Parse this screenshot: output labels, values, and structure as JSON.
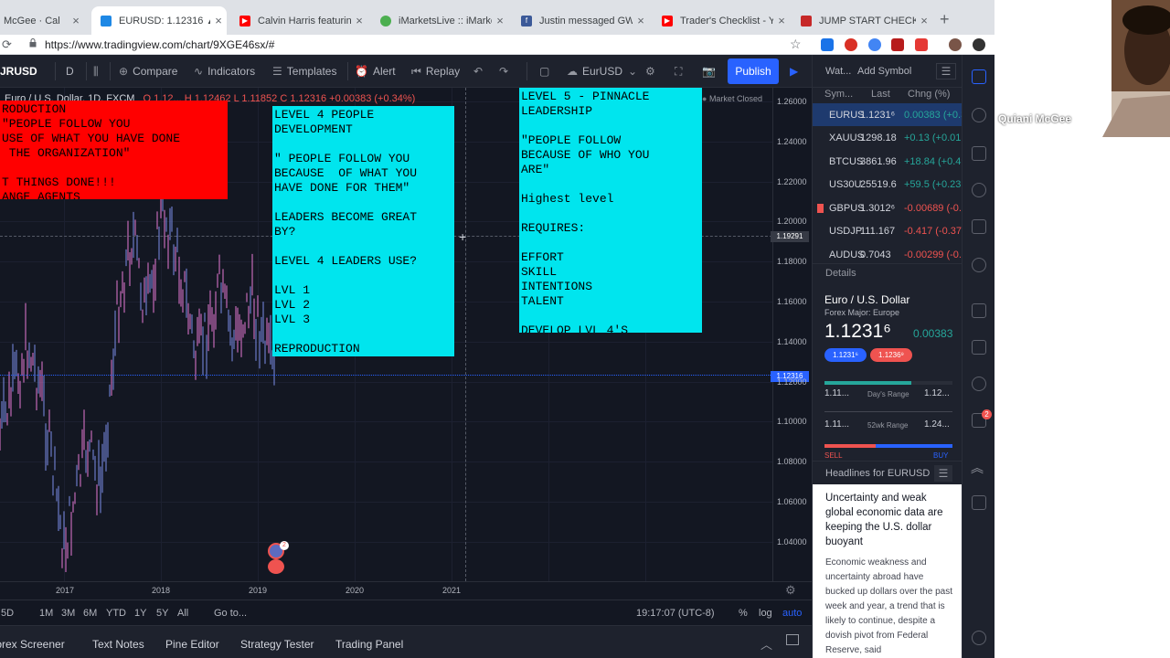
{
  "browser": {
    "tabs": [
      {
        "title": "McGee · Cal"
      },
      {
        "title": "EURUSD: 1.12316 ▲+0"
      },
      {
        "title": "Calvin Harris featuring"
      },
      {
        "title": "iMarketsLive :: iMarke"
      },
      {
        "title": "Justin messaged GWS"
      },
      {
        "title": "Trader's Checklist - Yo"
      },
      {
        "title": "JUMP START CHECK"
      }
    ],
    "url": "https://www.tradingview.com/chart/9XGE46sx/#"
  },
  "toolbar": {
    "symbol": "JRUSD",
    "interval": "D",
    "compare": "Compare",
    "indicators": "Indicators",
    "templates": "Templates",
    "alert": "Alert",
    "replay": "Replay",
    "layout": "EurUSD",
    "publish": "Publish"
  },
  "chart": {
    "legend_title": "Euro / U.S. Dollar, 1D, FXCM",
    "legend_ohlc": "O 1.12... H 1.12462 L 1.11852 C 1.12316 +0.00383 (+0.34%)",
    "market_status": "Market Closed",
    "price_tag": "1.12316",
    "crosshair_tag": "1.19291",
    "y_labels": [
      "1.26000",
      "1.24000",
      "1.22000",
      "1.20000",
      "1.18000",
      "1.16000",
      "1.14000",
      "1.12000",
      "1.10000",
      "1.08000",
      "1.06000",
      "1.04000"
    ],
    "x_labels": [
      "2017",
      "2018",
      "2019",
      "2020",
      "2021"
    ],
    "alert_count": "2",
    "notes": {
      "red": "RODUCTION\n\"PEOPLE FOLLOW YOU\nUSE OF WHAT YOU HAVE DONE\n THE ORGANIZATION\"\n\nT THINGS DONE!!!\nANGE AGENTS",
      "level4": "LEVEL 4 PEOPLE\nDEVELOPMENT\n\n\" PEOPLE FOLLOW YOU\nBECAUSE  OF WHAT YOU\nHAVE DONE FOR THEM\"\n\nLEADERS BECOME GREAT\nBY?\n\nLEVEL 4 LEADERS USE?\n\nLVL 1\nLVL 2\nLVL 3\n\nREPRODUCTION",
      "level5": "LEVEL 5 - PINNACLE\nLEADERSHIP\n\n\"PEOPLE FOLLOW\nBECAUSE OF WHO YOU\nARE\"\n\nHighest level\n\nREQUIRES:\n\nEFFORT\nSKILL\nINTENTIONS\nTALENT\n\nDEVELOP LVL 4'S"
    }
  },
  "range_bar": {
    "ranges": [
      "5D",
      "1M",
      "3M",
      "6M",
      "YTD",
      "1Y",
      "5Y",
      "All"
    ],
    "goto": "Go to...",
    "time": "19:17:07 (UTC-8)",
    "pct": "%",
    "log": "log",
    "auto": "auto"
  },
  "bottom_panel": {
    "tabs": [
      "Forex Screener",
      "Text Notes",
      "Pine Editor",
      "Strategy Tester",
      "Trading Panel"
    ]
  },
  "watchlist": {
    "title": "Wat...",
    "add_symbol": "Add Symbol",
    "columns": [
      "Sym...",
      "Last",
      "Chng (%)"
    ],
    "rows": [
      {
        "sym": "EURUS",
        "last": "1.1231⁶",
        "chg": "0.00383 (+0.3",
        "dir": "pos"
      },
      {
        "sym": "XAUUS",
        "last": "1298.18",
        "chg": "+0.13 (+0.01",
        "dir": "pos"
      },
      {
        "sym": "BTCUS",
        "last": "3861.96",
        "chg": "+18.84 (+0.49",
        "dir": "pos"
      },
      {
        "sym": "US30U",
        "last": "25519.6",
        "chg": "+59.5 (+0.23",
        "dir": "pos"
      },
      {
        "sym": "GBPUS",
        "last": "1.3012⁶",
        "chg": "-0.00689 (-0.5",
        "dir": "neg"
      },
      {
        "sym": "USDJP",
        "last": "111.167",
        "chg": "-0.417 (-0.37",
        "dir": "neg"
      },
      {
        "sym": "AUDUS",
        "last": "0.7043",
        "chg": "-0.00299 (-0.4",
        "dir": "neg"
      }
    ]
  },
  "details": {
    "header": "Details",
    "name": "Euro / U.S. Dollar",
    "category": "Forex Major: Europe",
    "price": "1.1231⁶",
    "change": "0.00383",
    "bid": "1.1231⁶",
    "ask": "1.1236⁹",
    "days_low": "1.11...",
    "days_label": "Day's Range",
    "days_high": "1.12...",
    "wk_low": "1.11...",
    "wk_label": "52wk Range",
    "wk_high": "1.24...",
    "sell": "SELL",
    "buy": "BUY",
    "day_range_fraction": 0.68
  },
  "headlines": {
    "title": "Headlines for EURUSD",
    "headline": "Uncertainty and weak global economic data are keeping the U.S. dollar buoyant",
    "body": "Economic weakness and uncertainty abroad have bucked up dollars over the past week and year, a trend that is likely to continue, despite a dovish pivot from Federal Reserve, said"
  },
  "right_strip": {
    "badge": "2"
  },
  "webcam": {
    "name": "Quiani McGee"
  },
  "colors": {
    "note_cyan": "#00e5ee",
    "note_red": "#ff0000",
    "accent": "#2962ff",
    "up": "#26a69a",
    "down": "#ef5350"
  }
}
